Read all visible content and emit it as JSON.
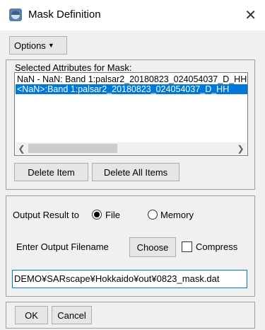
{
  "window": {
    "title": "Mask Definition",
    "icon": "app-icon",
    "close_glyph": "✕"
  },
  "toolbar": {
    "options_label": "Options",
    "options_arrow": "▼"
  },
  "attributes": {
    "label": "Selected Attributes for Mask:",
    "items": [
      "NaN - NaN: Band 1:palsar2_20180823_024054037_D_HH",
      "<NaN>:Band 1:palsar2_20180823_024054037_D_HH"
    ],
    "selected_index": 1,
    "delete_item_label": "Delete Item",
    "delete_all_label": "Delete All Items"
  },
  "output": {
    "result_label": "Output Result to",
    "file_label": "File",
    "memory_label": "Memory",
    "selected": "File",
    "filename_label": "Enter Output Filename",
    "choose_label": "Choose",
    "compress_label": "Compress",
    "compress_checked": false,
    "filename_value": "DEMO¥SARscape¥Hokkaido¥out¥0823_mask.dat"
  },
  "footer": {
    "ok_label": "OK",
    "cancel_label": "Cancel"
  }
}
